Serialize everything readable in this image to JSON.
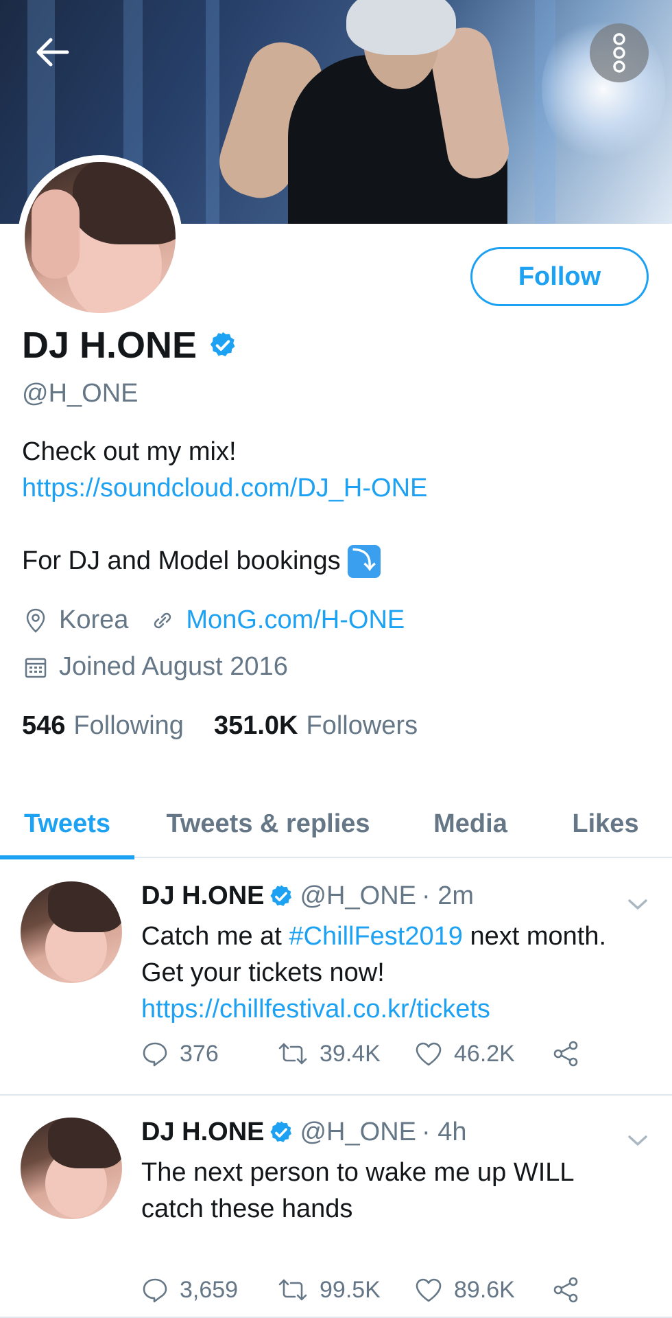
{
  "header": {
    "back_icon": "arrow-left-icon",
    "more_icon": "more-vertical-icon"
  },
  "profile": {
    "display_name": "DJ H.ONE",
    "handle": "@H_ONE",
    "follow_label": "Follow",
    "bio_line1": "Check out my mix!",
    "bio_link": "https://soundcloud.com/DJ_H-ONE",
    "bio_line2": "For DJ and Model bookings",
    "bio_emoji": "⤵",
    "location": "Korea",
    "website": "MonG.com/H-ONE",
    "joined": "Joined August 2016",
    "following_count": "546",
    "following_label": "Following",
    "followers_count": "351.0K",
    "followers_label": "Followers"
  },
  "tabs": [
    {
      "label": "Tweets",
      "active": true
    },
    {
      "label": "Tweets & replies",
      "active": false
    },
    {
      "label": "Media",
      "active": false
    },
    {
      "label": "Likes",
      "active": false
    }
  ],
  "tweets": [
    {
      "name": "DJ H.ONE",
      "handle": "@H_ONE",
      "time": "· 2m",
      "text_a": "Catch me at ",
      "hashtag": "#ChillFest2019",
      "text_b": " next month. Get your tickets now!",
      "link": "https://chillfestival.co.kr/tickets",
      "replies": "376",
      "retweets": "39.4K",
      "likes": "46.2K"
    },
    {
      "name": "DJ H.ONE",
      "handle": "@H_ONE",
      "time": "· 4h",
      "text": "The next person to wake me up WILL catch these hands",
      "replies": "3,659",
      "retweets": "99.5K",
      "likes": "89.6K"
    }
  ],
  "colors": {
    "accent": "#1da1f2",
    "secondary_text": "#657786",
    "primary_text": "#14171a",
    "divider": "#e1e8ed"
  }
}
